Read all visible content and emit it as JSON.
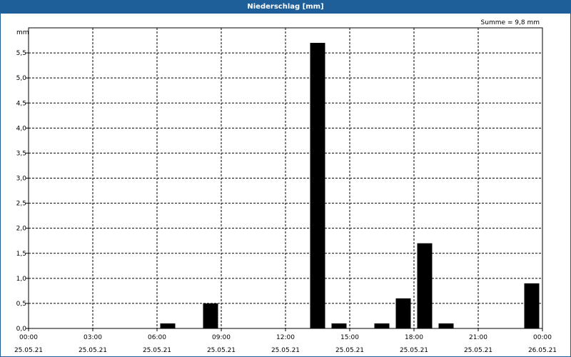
{
  "window": {
    "title": "Niederschlag [mm]"
  },
  "chart_data": {
    "type": "bar",
    "title": "Niederschlag [mm]",
    "ylabel": "mm",
    "xlabel": "",
    "annotation": "Summe = 9,8 mm",
    "ylim": [
      0,
      6
    ],
    "xlim_hours": [
      0,
      24
    ],
    "y_ticks": [
      "0,0",
      "0,5",
      "1,0",
      "1,5",
      "2,0",
      "2,5",
      "3,0",
      "3,5",
      "4,0",
      "4,5",
      "5,0",
      "5,5"
    ],
    "y_tick_values": [
      0,
      0.5,
      1.0,
      1.5,
      2.0,
      2.5,
      3.0,
      3.5,
      4.0,
      4.5,
      5.0,
      5.5
    ],
    "x_ticks": [
      {
        "time": "00:00",
        "date": "25.05.21"
      },
      {
        "time": "03:00",
        "date": "25.05.21"
      },
      {
        "time": "06:00",
        "date": "25.05.21"
      },
      {
        "time": "09:00",
        "date": "25.05.21"
      },
      {
        "time": "12:00",
        "date": "25.05.21"
      },
      {
        "time": "15:00",
        "date": "25.05.21"
      },
      {
        "time": "18:00",
        "date": "25.05.21"
      },
      {
        "time": "21:00",
        "date": "25.05.21"
      },
      {
        "time": "00:00",
        "date": "26.05.21"
      }
    ],
    "bars": [
      {
        "x": "25.05.21 06:00-07:00",
        "value": 0.1
      },
      {
        "x": "25.05.21 08:00-09:00",
        "value": 0.5
      },
      {
        "x": "25.05.21 13:00-14:00",
        "value": 5.7
      },
      {
        "x": "25.05.21 14:00-15:00",
        "value": 0.1
      },
      {
        "x": "25.05.21 16:00-17:00",
        "value": 0.1
      },
      {
        "x": "25.05.21 17:00-18:00",
        "value": 0.6
      },
      {
        "x": "25.05.21 18:00-19:00",
        "value": 1.7
      },
      {
        "x": "25.05.21 19:00-20:00",
        "value": 0.1
      },
      {
        "x": "25.05.21 23:00-26.05.21 00:00",
        "value": 0.9
      }
    ],
    "bar_color": "#000000",
    "grid": true
  }
}
